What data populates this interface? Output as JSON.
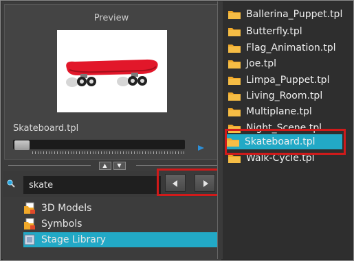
{
  "preview": {
    "title": "Preview",
    "file_name": "Skateboard.tpl"
  },
  "search": {
    "value": "skate",
    "placeholder": ""
  },
  "library_tree": [
    {
      "label": "3D Models",
      "icon": "folder-doc-icon",
      "selected": false
    },
    {
      "label": "Symbols",
      "icon": "folder-doc-icon",
      "selected": false
    },
    {
      "label": "Stage Library",
      "icon": "library-box-icon",
      "selected": true
    }
  ],
  "templates": [
    {
      "label": "Ballerina_Puppet.tpl",
      "selected": false
    },
    {
      "label": "Butterfly.tpl",
      "selected": false
    },
    {
      "label": "Flag_Animation.tpl",
      "selected": false
    },
    {
      "label": "Joe.tpl",
      "selected": false
    },
    {
      "label": "Limpa_Puppet.tpl",
      "selected": false
    },
    {
      "label": "Living_Room.tpl",
      "selected": false
    },
    {
      "label": "Multiplane.tpl",
      "selected": false
    },
    {
      "label": "Night_Scene.tpl",
      "selected": false
    },
    {
      "label": "Skateboard.tpl",
      "selected": true
    },
    {
      "label": "Walk-Cycle.tpl",
      "selected": false
    }
  ],
  "colors": {
    "selection": "#22a9c6",
    "highlight_box": "#d11a1a",
    "folder": "#f0a829",
    "play": "#2c8fd8"
  }
}
